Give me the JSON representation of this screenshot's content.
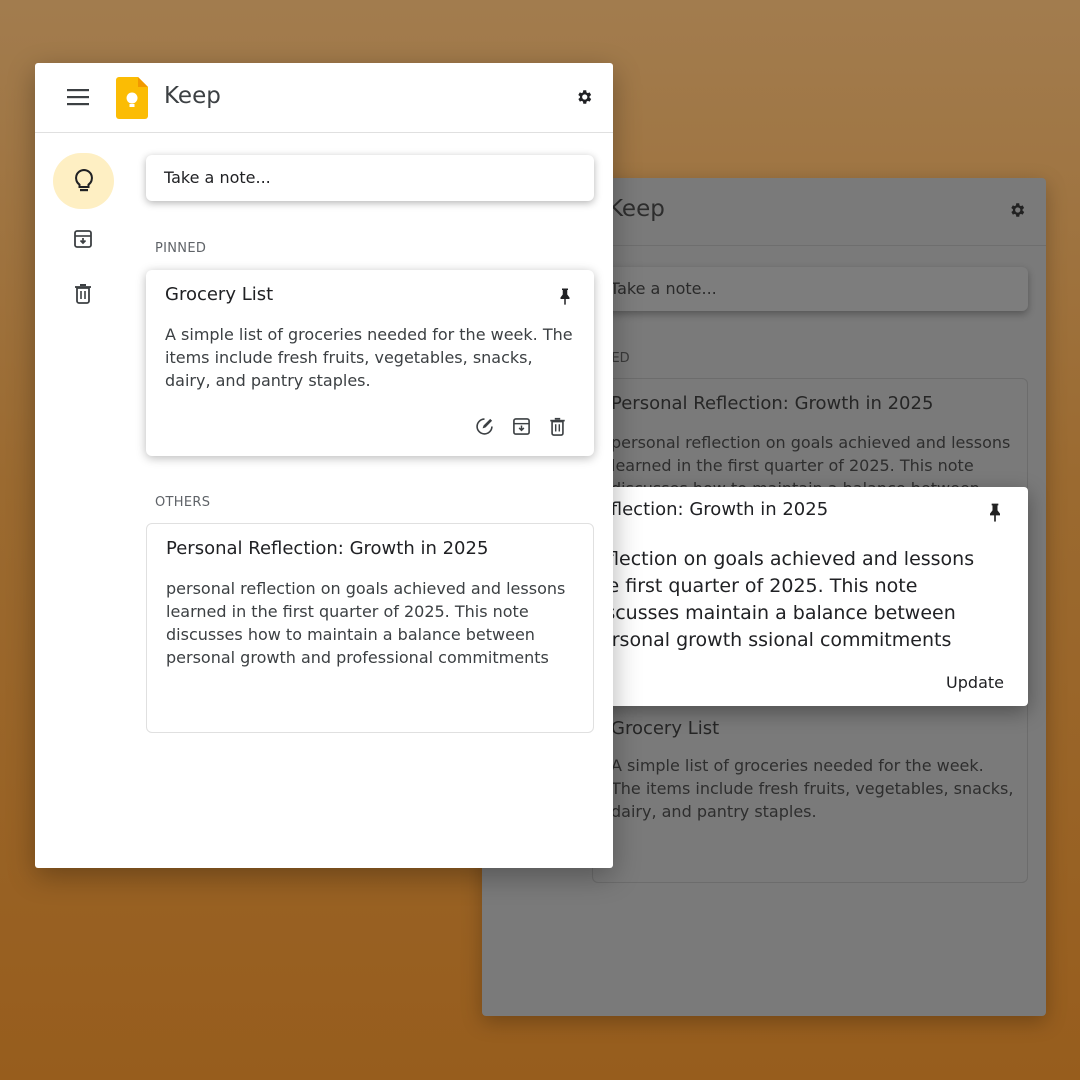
{
  "app": {
    "title": "Keep"
  },
  "sidebar": {
    "items": [
      {
        "name": "notes",
        "icon": "lightbulb-icon",
        "active": true
      },
      {
        "name": "archive",
        "icon": "archive-icon",
        "active": false
      },
      {
        "name": "trash",
        "icon": "trash-icon",
        "active": false
      }
    ]
  },
  "take_note": {
    "placeholder": "Take a note..."
  },
  "sections": {
    "pinned_label": "PINNED",
    "others_label": "OTHERS"
  },
  "notes": {
    "pinned": {
      "title": "Grocery List",
      "body": "A simple list of groceries needed for the week. The items include fresh fruits, vegetables, snacks, dairy, and pantry staples."
    },
    "other": {
      "title": "Personal Reflection: Growth in 2025",
      "body": "personal reflection on goals achieved and lessons learned in the first quarter of 2025. This note discusses how to maintain a balance between personal growth and professional commitments"
    }
  },
  "back_window": {
    "title": "Keep",
    "take_note": "Take a note...",
    "pinned_label": "NNED",
    "pinned_note_title": "Personal Reflection: Growth in 2025",
    "pinned_note_body": "personal reflection on goals achieved and lessons learned in the first quarter of 2025. This note discusses how to maintain a balance between",
    "other_note_title": "Grocery List",
    "other_note_body": "A simple list of groceries needed for the week. The items include fresh fruits, vegetables, snacks, dairy, and pantry staples."
  },
  "edit_popup": {
    "title": "Reflection: Growth in 2025",
    "body": "reflection on goals achieved and lessons the first quarter of 2025. This note discusses maintain a balance between personal growth ssional commitments",
    "update_label": "Update"
  },
  "colors": {
    "accent": "#fbbc04",
    "active_nav": "#feefc3",
    "text": "#202124"
  }
}
